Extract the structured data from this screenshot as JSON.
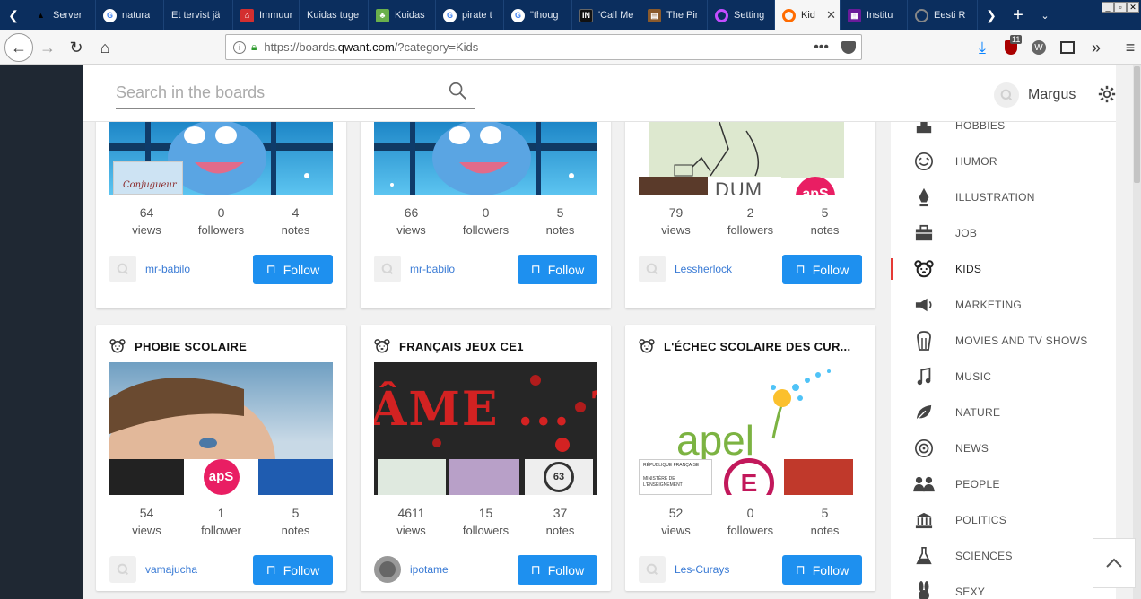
{
  "browser": {
    "tabs": [
      {
        "label": "Server",
        "icon": "warning-icon",
        "color": "#f7c600"
      },
      {
        "label": "natura",
        "icon": "google-icon",
        "color": "#4285f4"
      },
      {
        "label": "Et tervist jä",
        "icon": "",
        "color": ""
      },
      {
        "label": "Immuur",
        "icon": "ohtuleht-icon",
        "color": "#d32f2f"
      },
      {
        "label": "Kuidas tuge",
        "icon": "",
        "color": ""
      },
      {
        "label": "Kuidas",
        "icon": "leaf-icon",
        "color": "#6ab04c"
      },
      {
        "label": "pirate t",
        "icon": "google-icon",
        "color": "#4285f4"
      },
      {
        "label": "\"thoug",
        "icon": "google-icon",
        "color": "#4285f4"
      },
      {
        "label": "'Call Me",
        "icon": "in-icon",
        "color": "#111111"
      },
      {
        "label": "The Pir",
        "icon": "book-icon",
        "color": "#8b5a2b"
      },
      {
        "label": "Setting",
        "icon": "qwant-icon",
        "color": "#c44dff"
      },
      {
        "label": "Kid",
        "icon": "qwant-icon",
        "color": "#ff6b00",
        "active": true
      },
      {
        "label": "Institu",
        "icon": "grid-icon",
        "color": "#6a1b9a"
      },
      {
        "label": "Eesti R",
        "icon": "globe-icon",
        "color": "#888888"
      }
    ],
    "url_prefix": "https://boards.",
    "url_domain": "qwant.com",
    "url_path": "/?category=Kids",
    "extension_badge": "11"
  },
  "header": {
    "search_placeholder": "Search in the boards",
    "username": "Margus"
  },
  "boards": [
    {
      "title": "",
      "image": "dolphin",
      "views": "64",
      "views_label": "views",
      "followers": "0",
      "followers_label": "followers",
      "notes": "4",
      "notes_label": "notes",
      "owner": "mr-babilo",
      "follow_label": "Follow"
    },
    {
      "title": "",
      "image": "dolphin",
      "views": "66",
      "views_label": "views",
      "followers": "0",
      "followers_label": "followers",
      "notes": "5",
      "notes_label": "notes",
      "owner": "mr-babilo",
      "follow_label": "Follow"
    },
    {
      "title": "",
      "image": "sketch",
      "views": "79",
      "views_label": "views",
      "followers": "2",
      "followers_label": "followers",
      "notes": "5",
      "notes_label": "notes",
      "owner": "Lessherlock",
      "follow_label": "Follow"
    },
    {
      "title": "PHOBIE SCOLAIRE",
      "image": "child",
      "views": "54",
      "views_label": "views",
      "followers": "1",
      "followers_label": "follower",
      "notes": "5",
      "notes_label": "notes",
      "owner": "vamajucha",
      "follow_label": "Follow"
    },
    {
      "title": "FRANÇAIS JEUX CE1",
      "image": "game",
      "views": "4611",
      "views_label": "views",
      "followers": "15",
      "followers_label": "followers",
      "notes": "37",
      "notes_label": "notes",
      "owner": "ipotame",
      "follow_label": "Follow"
    },
    {
      "title": "L'ÉCHEC SCOLAIRE DES CUR...",
      "image": "apel",
      "views": "52",
      "views_label": "views",
      "followers": "0",
      "followers_label": "followers",
      "notes": "5",
      "notes_label": "notes",
      "owner": "Les-Curays",
      "follow_label": "Follow"
    }
  ],
  "image_text": {
    "conjugueur": "Conjugueur",
    "dum": "DUM",
    "aps": "apS",
    "ame": "ÂME ... ?",
    "number63": "63",
    "apel": "apel",
    "ministere": "MINISTÈRE DE L'ENSEIGNEMENT",
    "republique": "RÉPUBLIQUE FRANÇAISE",
    "e_letter": "E"
  },
  "categories": [
    {
      "label": "HOBBIES",
      "icon": "hobbies-icon"
    },
    {
      "label": "HUMOR",
      "icon": "humor-icon"
    },
    {
      "label": "ILLUSTRATION",
      "icon": "illustration-icon"
    },
    {
      "label": "JOB",
      "icon": "job-icon"
    },
    {
      "label": "KIDS",
      "icon": "kids-icon",
      "active": true
    },
    {
      "label": "MARKETING",
      "icon": "marketing-icon"
    },
    {
      "label": "MOVIES AND TV SHOWS",
      "icon": "movies-icon"
    },
    {
      "label": "MUSIC",
      "icon": "music-icon"
    },
    {
      "label": "NATURE",
      "icon": "nature-icon"
    },
    {
      "label": "NEWS",
      "icon": "news-icon"
    },
    {
      "label": "PEOPLE",
      "icon": "people-icon"
    },
    {
      "label": "POLITICS",
      "icon": "politics-icon"
    },
    {
      "label": "SCIENCES",
      "icon": "sciences-icon"
    },
    {
      "label": "SEXY",
      "icon": "sexy-icon"
    }
  ],
  "colors": {
    "accent": "#1e90ef",
    "active_marker": "#e53935",
    "link": "#3a7bd5",
    "tabbar": "#0b2e5e"
  }
}
